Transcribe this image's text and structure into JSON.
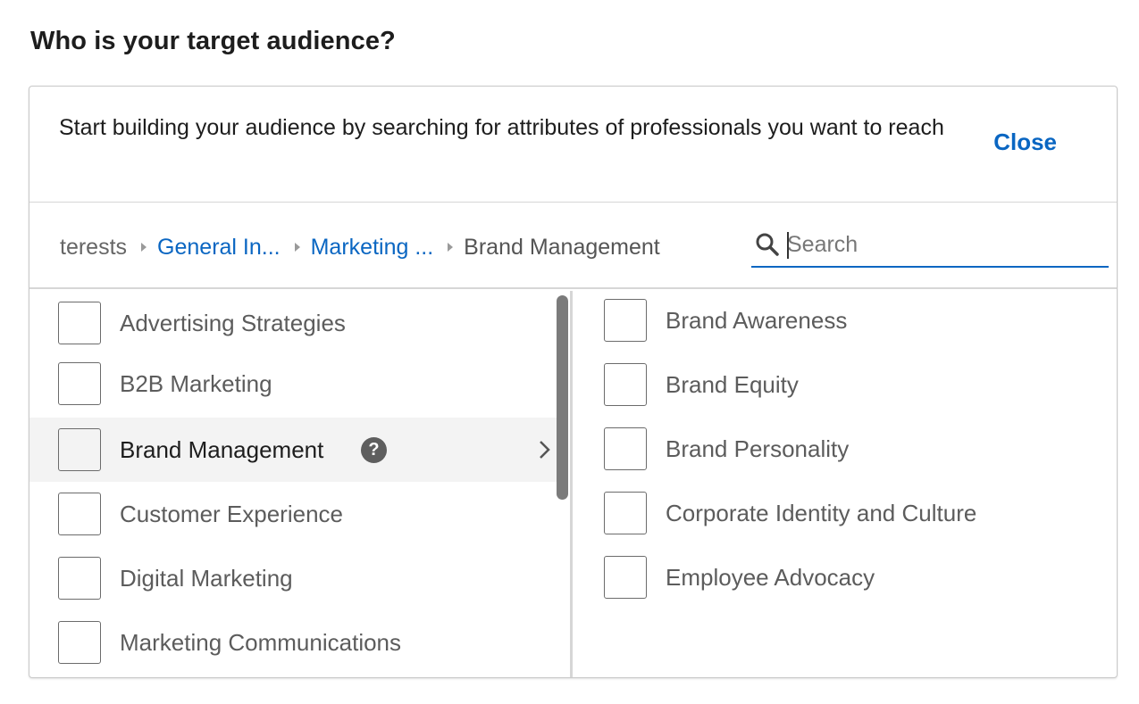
{
  "title": "Who is your target audience?",
  "intro": "Start building your audience by searching for attributes of professionals you want to reach",
  "close_label": "Close",
  "breadcrumbs": {
    "crumb0": "terests",
    "crumb1": "General In...",
    "crumb2": "Marketing ...",
    "crumb3": "Brand Management"
  },
  "search": {
    "placeholder": "Search",
    "value": ""
  },
  "left_items": [
    {
      "label": "Advertising Strategies",
      "checked": false
    },
    {
      "label": "B2B Marketing",
      "checked": false
    },
    {
      "label": "Brand Management",
      "checked": false,
      "active": true,
      "help_glyph": "?"
    },
    {
      "label": "Customer Experience",
      "checked": false
    },
    {
      "label": "Digital Marketing",
      "checked": false
    },
    {
      "label": "Marketing Communications",
      "checked": false
    }
  ],
  "right_items": [
    {
      "label": "Brand Awareness",
      "checked": false
    },
    {
      "label": "Brand Equity",
      "checked": false
    },
    {
      "label": "Brand Personality",
      "checked": false
    },
    {
      "label": "Corporate Identity and Culture",
      "checked": false
    },
    {
      "label": "Employee Advocacy",
      "checked": false
    }
  ],
  "colors": {
    "accent": "#0a66c2",
    "active_row": "#f3f3f3",
    "text_muted": "#5c5c5c"
  },
  "icons": {
    "search": "magnifier-icon",
    "help": "question-circle-icon",
    "expand": "chevron-right-icon",
    "crumb_sep": "caret-right-icon"
  }
}
